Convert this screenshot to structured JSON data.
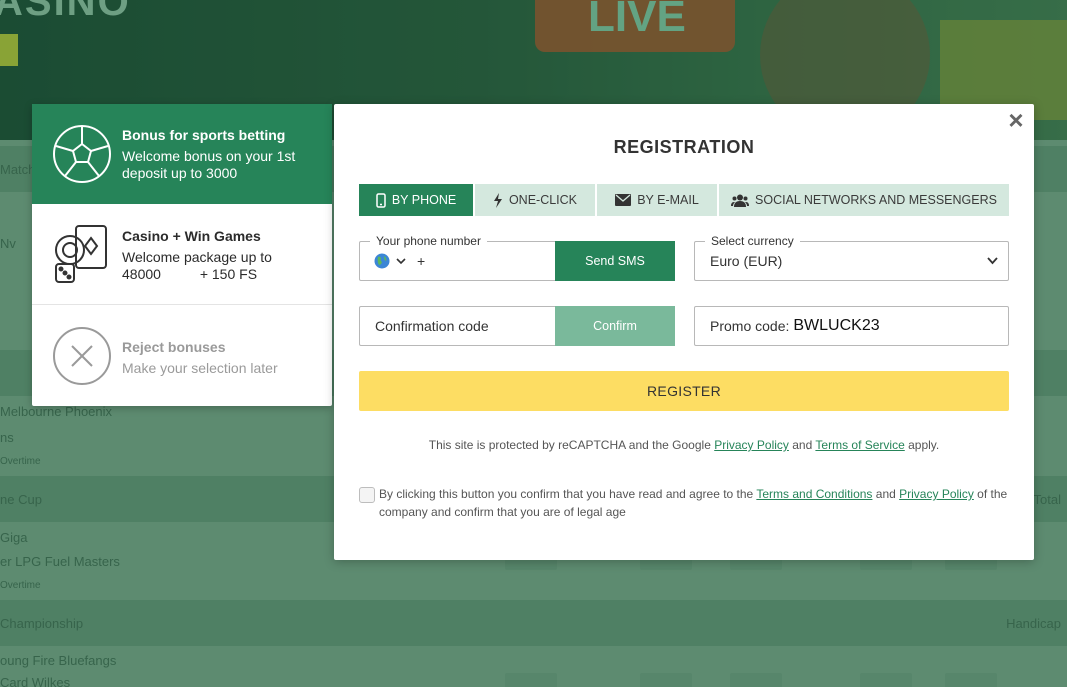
{
  "background": {
    "banner_title": "ASINO",
    "live_label": "LIVE",
    "rows": [
      {
        "text": "Match",
        "right": ""
      },
      {
        "text": "Melbourne Phoenix",
        "right": ""
      },
      {
        "text": "ns",
        "right": ""
      },
      {
        "text": "Overtime",
        "right": ""
      },
      {
        "text": "ne Cup",
        "right": "Total"
      },
      {
        "text": "Giga",
        "right": ""
      },
      {
        "text": "er LPG Fuel Masters",
        "right": ""
      },
      {
        "text": "Overtime",
        "right": ""
      },
      {
        "text": "Championship",
        "right": "Handicap"
      },
      {
        "text": "oung Fire Bluefangs",
        "right": ""
      },
      {
        "text": "Card Wilkes",
        "right": ""
      }
    ]
  },
  "bonus_panel": {
    "items": [
      {
        "icon": "soccer-ball-icon",
        "title": "Bonus for sports betting",
        "text": "Welcome bonus on your 1st deposit up to 3000"
      },
      {
        "icon": "casino-icon",
        "title": "Casino + Win Games",
        "text": "Welcome package up to 48000          + 150 FS"
      },
      {
        "icon": "reject-icon",
        "title": "Reject bonuses",
        "text": "Make your selection later"
      }
    ]
  },
  "registration": {
    "close_label": "×",
    "title": "REGISTRATION",
    "tabs": [
      {
        "label": "BY PHONE",
        "icon": "phone-icon",
        "active": true
      },
      {
        "label": "ONE-CLICK",
        "icon": "lightning-icon",
        "active": false
      },
      {
        "label": "BY E-MAIL",
        "icon": "envelope-icon",
        "active": false
      },
      {
        "label": "SOCIAL NETWORKS AND MESSENGERS",
        "icon": "users-icon",
        "active": false
      }
    ],
    "phone": {
      "legend": "Your phone number",
      "prefix": "+",
      "send_label": "Send SMS"
    },
    "currency": {
      "legend": "Select currency",
      "value": "Euro (EUR)"
    },
    "confirmation": {
      "placeholder": "Confirmation code",
      "confirm_label": "Confirm"
    },
    "promo": {
      "label": "Promo code:",
      "value": "BWLUCK23"
    },
    "register_label": "REGISTER",
    "captcha": {
      "prefix": "This site is protected by reCAPTCHA and the Google",
      "privacy": "Privacy Policy",
      "and": "and",
      "terms": "Terms of Service",
      "suffix": "apply."
    },
    "agree": {
      "prefix": "By clicking this button you confirm that you have read and agree to the",
      "terms": "Terms and Conditions",
      "and": "and",
      "privacy": "Privacy Policy",
      "suffix": "of the company and confirm that you are of legal age"
    }
  },
  "colors": {
    "green": "#268459",
    "light_green": "#7ab99b",
    "tab_bg": "#d4e8de",
    "register": "#fddd63"
  }
}
